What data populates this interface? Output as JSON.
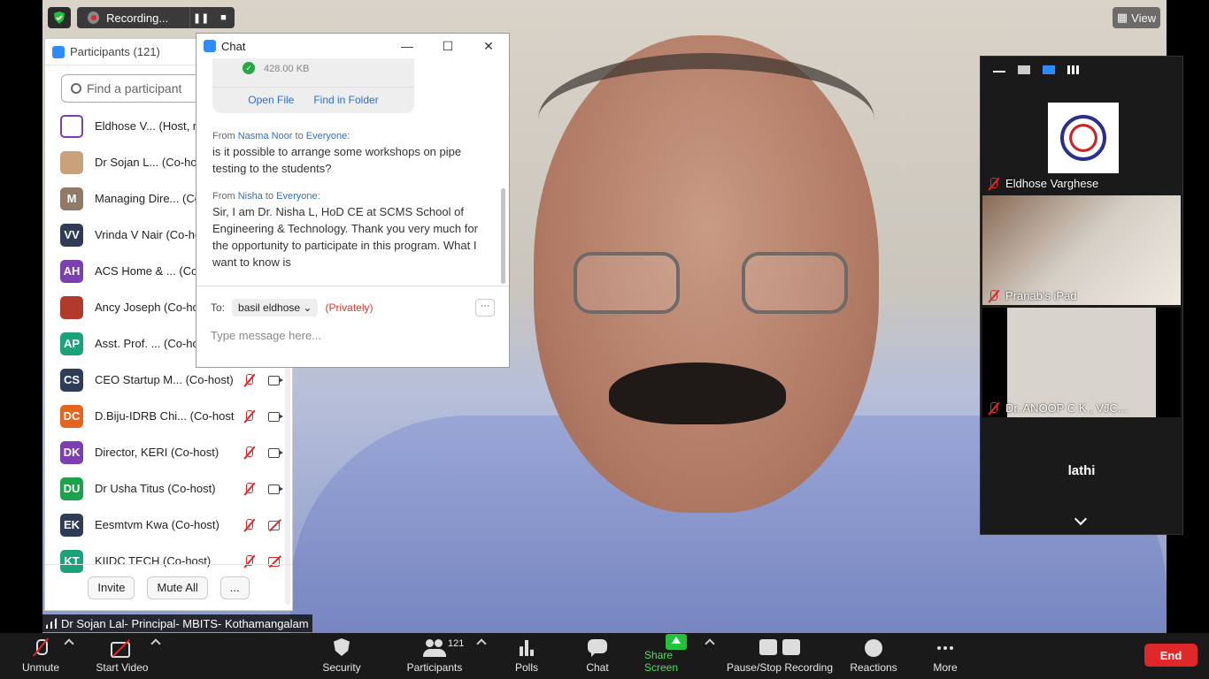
{
  "recording": {
    "label": "Recording..."
  },
  "view_button": {
    "label": "View"
  },
  "participants_panel": {
    "title": "Participants (121)",
    "search_placeholder": "Find a participant",
    "items": [
      {
        "name": "Eldhose V... (Host, me)",
        "initials": "",
        "color": "#ffffff",
        "mic": "none",
        "cam": "none"
      },
      {
        "name": "Dr Sojan L... (Co-host)",
        "initials": "",
        "color": "#c7a27a",
        "mic": "none",
        "cam": "none"
      },
      {
        "name": "Managing Dire... (Co-host)",
        "initials": "M",
        "color": "#8e7a66",
        "mic": "none",
        "cam": "none"
      },
      {
        "name": "Vrinda V Nair (Co-host)",
        "initials": "VV",
        "color": "#2e3d55",
        "mic": "none",
        "cam": "none"
      },
      {
        "name": "ACS Home & ... (Co-host)",
        "initials": "AH",
        "color": "#7b3fb0",
        "mic": "none",
        "cam": "none"
      },
      {
        "name": "Ancy Joseph (Co-host)",
        "initials": "",
        "color": "#b23a2a",
        "mic": "none",
        "cam": "none"
      },
      {
        "name": "Asst. Prof. ... (Co-host)",
        "initials": "AP",
        "color": "#1aa37a",
        "mic": "none",
        "cam": "none"
      },
      {
        "name": "CEO Startup M... (Co-host)",
        "initials": "CS",
        "color": "#2e3d55",
        "mic": "off",
        "cam": "on"
      },
      {
        "name": "D.Biju-IDRB Chi... (Co-host)",
        "initials": "DC",
        "color": "#e5641e",
        "mic": "off",
        "cam": "on"
      },
      {
        "name": "Director, KERI (Co-host)",
        "initials": "DK",
        "color": "#7b3fb0",
        "mic": "off",
        "cam": "on"
      },
      {
        "name": "Dr Usha Titus (Co-host)",
        "initials": "DU",
        "color": "#1aa34a",
        "mic": "off",
        "cam": "on"
      },
      {
        "name": "Eesmtvm Kwa (Co-host)",
        "initials": "EK",
        "color": "#2e3d55",
        "mic": "off",
        "cam": "off"
      },
      {
        "name": "KIIDC TECH (Co-host)",
        "initials": "KT",
        "color": "#1aa37a",
        "mic": "off",
        "cam": "off"
      }
    ],
    "invite_label": "Invite",
    "mute_all_label": "Mute All",
    "more_label": "..."
  },
  "chat": {
    "title": "Chat",
    "file_size": "428.00 KB",
    "open_file": "Open File",
    "find_in_folder": "Find in Folder",
    "messages": [
      {
        "from_prefix": "From",
        "sender": "Nasma Noor",
        "to_word": "to",
        "recipient": "Everyone:",
        "text": "is it possible to arrange some workshops on pipe testing to the students?"
      },
      {
        "from_prefix": "From",
        "sender": "Nisha",
        "to_word": "to",
        "recipient": "Everyone:",
        "text": "Sir, I am Dr. Nisha L, HoD CE at SCMS School of Engineering & Technology. Thank you very much for the opportunity to participate in this program. What I want to know is"
      }
    ],
    "to_label": "To:",
    "recipient_select": "basil eldhose",
    "privately": "(Privately)",
    "more": "···",
    "input_placeholder": "Type message here..."
  },
  "gallery": {
    "tiles": [
      {
        "name": "Eldhose Varghese"
      },
      {
        "name": "Pranab's iPad"
      },
      {
        "name": "Dr. ANOOP C K , VJC..."
      }
    ],
    "text_tile": "lathi"
  },
  "active_speaker": "Dr Sojan Lal- Principal- MBITS- Kothamangalam",
  "toolbar": {
    "unmute": "Unmute",
    "start_video": "Start Video",
    "security": "Security",
    "participants": "Participants",
    "participants_count": "121",
    "polls": "Polls",
    "chat": "Chat",
    "share_screen": "Share Screen",
    "pause_stop": "Pause/Stop Recording",
    "reactions": "Reactions",
    "more": "More",
    "end": "End"
  }
}
